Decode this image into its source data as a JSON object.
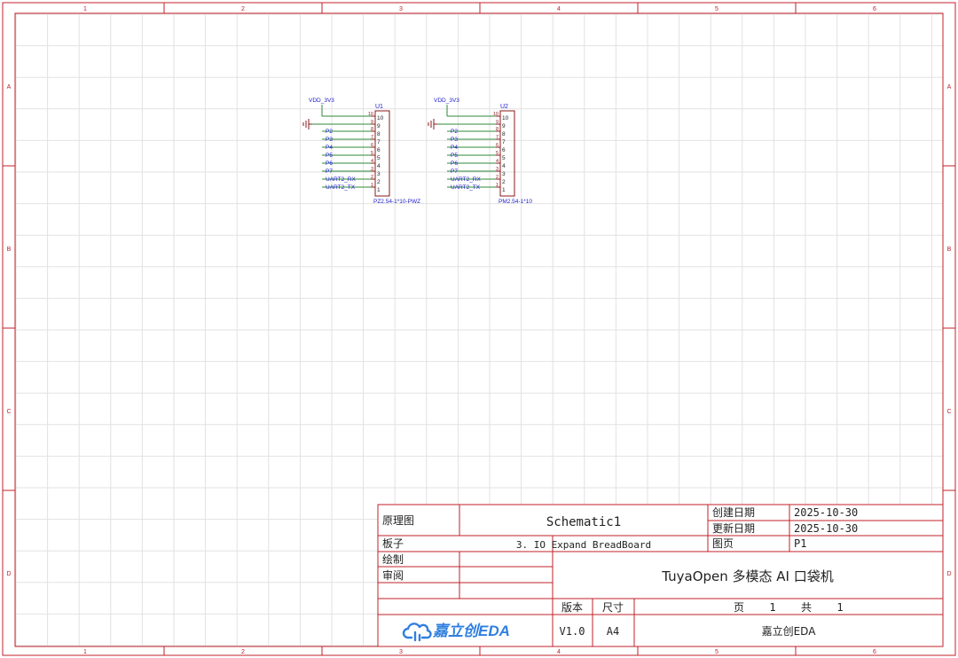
{
  "sheet": {
    "column_labels": [
      "1",
      "2",
      "3",
      "4",
      "5",
      "6"
    ],
    "row_labels": [
      "A",
      "B",
      "C",
      "D"
    ]
  },
  "components": [
    {
      "ref": "U1",
      "footprint": "PZ2.54-1*10-PWZ",
      "power_label": "VDD_3V3",
      "pin_numbers_inside": [
        "10",
        "9",
        "8",
        "7",
        "6",
        "5",
        "4",
        "3",
        "2",
        "1"
      ],
      "pin_numbers_outside": [
        "10",
        "9",
        "8",
        "7",
        "6",
        "5",
        "4",
        "3",
        "2",
        "1"
      ],
      "net_labels": [
        "",
        "",
        "P2",
        "P3",
        "P4",
        "P5",
        "P6",
        "P7",
        "UART2_RX",
        "UART2_TX"
      ]
    },
    {
      "ref": "U2",
      "footprint": "PM2.54-1*10",
      "power_label": "VDD_3V3",
      "pin_numbers_inside": [
        "10",
        "9",
        "8",
        "7",
        "6",
        "5",
        "4",
        "3",
        "2",
        "1"
      ],
      "pin_numbers_outside": [
        "10",
        "9",
        "8",
        "7",
        "6",
        "5",
        "4",
        "3",
        "2",
        "1"
      ],
      "net_labels": [
        "",
        "",
        "P2",
        "P3",
        "P4",
        "P5",
        "P6",
        "P7",
        "UART2_RX",
        "UART2_TX"
      ]
    }
  ],
  "title_block": {
    "schematic_label": "原理图",
    "schematic_name": "Schematic1",
    "board_label": "板子",
    "board_name": "3. IO Expand BreadBoard",
    "drawn_label": "绘制",
    "review_label": "审阅",
    "created_label": "创建日期",
    "created_date": "2025-10-30",
    "updated_label": "更新日期",
    "updated_date": "2025-10-30",
    "page_label": "图页",
    "page_value": "P1",
    "project_title": "TuyaOpen 多模态 AI 口袋机",
    "version_label": "版本",
    "version_value": "V1.0",
    "size_label": "尺寸",
    "size_value": "A4",
    "page_word": "页",
    "page_number": "1",
    "total_word": "共",
    "total_pages": "1",
    "logo_text": "嘉立创EDA",
    "company": "嘉立创EDA"
  },
  "colors": {
    "border": "#c0202a",
    "grid": "#e2e2e2",
    "pin": "#8a1a1a",
    "wire": "#2f8a3a",
    "net_label": "#1a1acc",
    "ground": "#8a1a1a",
    "logo": "#2f7fe0"
  }
}
